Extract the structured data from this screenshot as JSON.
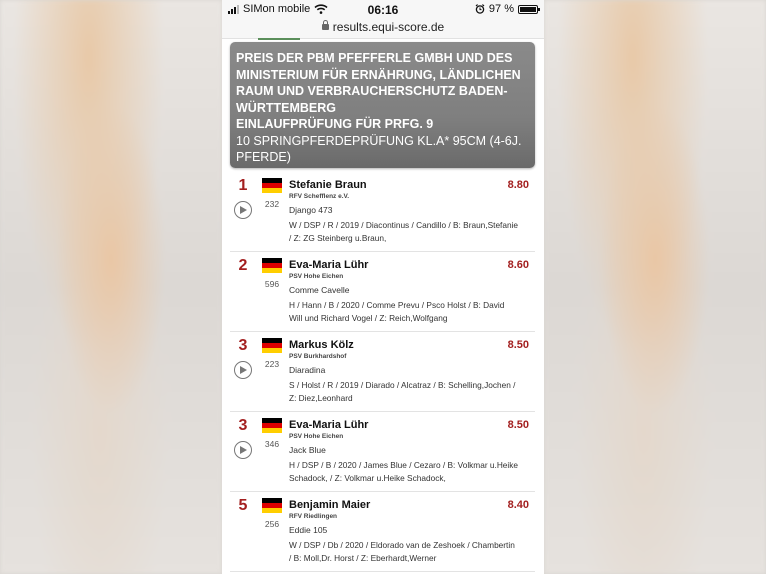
{
  "status_bar": {
    "carrier": "SIMon mobile",
    "time": "06:16",
    "battery_pct_label": "97 %",
    "battery_level": 0.97
  },
  "url_bar": {
    "url": "results.equi-score.de",
    "icon": "lock-icon"
  },
  "title": {
    "sponsor": "PREIS DER PBM PFEFFERLE GMBH UND DES MINISTERIUM FÜR ERNÄHRUNG, LÄNDLICHEN RAUM UND VERBRAUCHERSCHUTZ BADEN-WÜRTTEMBERG",
    "competition": "EINLAUFPRÜFUNG FÜR PRFG. 9",
    "class": "10 SPRINGPFERDEPRÜFUNG KL.A* 95CM (4-6J. PFERDE)"
  },
  "results": [
    {
      "rank": "1",
      "head_no": "232",
      "rider": "Stefanie Braun",
      "club": "RFV Schefflenz e.V.",
      "horse": "Django 473",
      "details": "W / DSP / R / 2019 / Diacontinus / Candillo / B: Braun,Stefanie / Z: ZG Steinberg u.Braun,",
      "score": "8.80",
      "has_video": true
    },
    {
      "rank": "2",
      "head_no": "596",
      "rider": "Eva-Maria Lühr",
      "club": "PSV Hohe Eichen",
      "horse": "Comme Cavelle",
      "details": "H / Hann / B / 2020 / Comme Prevu / Psco Holst / B: David Will und Richard Vogel / Z: Reich,Wolfgang",
      "score": "8.60",
      "has_video": false
    },
    {
      "rank": "3",
      "head_no": "223",
      "rider": "Markus Kölz",
      "club": "PSV Burkhardshof",
      "horse": "Diaradina",
      "details": "S / Holst / R / 2019 / Diarado / Alcatraz / B: Schelling,Jochen / Z: Diez,Leonhard",
      "score": "8.50",
      "has_video": true
    },
    {
      "rank": "3",
      "head_no": "346",
      "rider": "Eva-Maria Lühr",
      "club": "PSV Hohe Eichen",
      "horse": "Jack Blue",
      "details": "H / DSP / B / 2020 / James Blue / Cezaro / B: Volkmar u.Heike Schadock, / Z: Volkmar u.Heike Schadock,",
      "score": "8.50",
      "has_video": true
    },
    {
      "rank": "5",
      "head_no": "256",
      "rider": "Benjamin Maier",
      "club": "RFV Riedlingen",
      "horse": "Eddie 105",
      "details": "W / DSP / Db / 2020 / Eldorado van de Zeshoek / Chambertin / B: Moll,Dr. Horst / Z: Eberhardt,Werner",
      "score": "8.40",
      "has_video": false
    }
  ],
  "colors": {
    "accent": "#a31f1f",
    "title_box": "#808080"
  }
}
